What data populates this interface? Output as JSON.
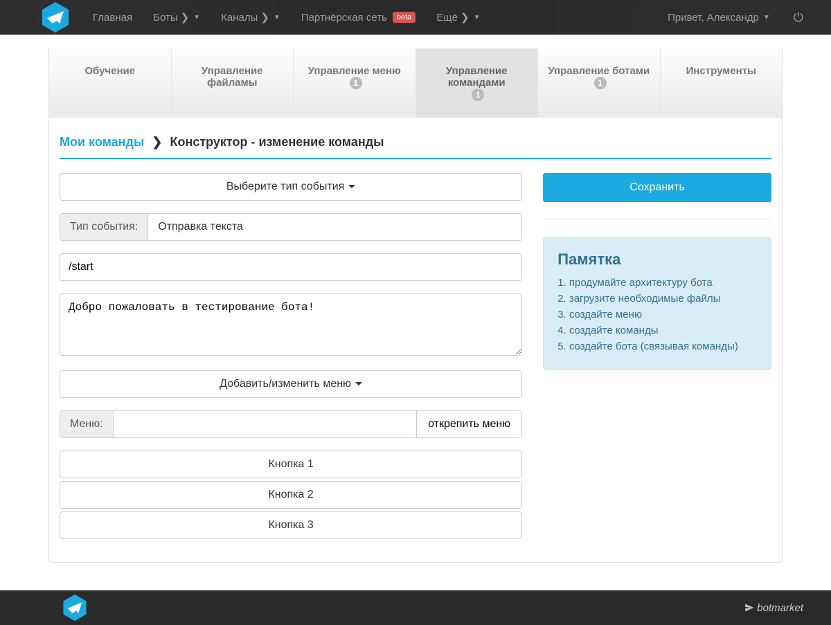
{
  "nav": {
    "items": [
      {
        "label": "Главная"
      },
      {
        "label": "Боты",
        "dropdown": true
      },
      {
        "label": "Каналы",
        "dropdown": true
      },
      {
        "label": "Партнёрская сеть",
        "beta": true,
        "beta_label": "beta"
      },
      {
        "label": "Ещё",
        "dropdown": true
      }
    ],
    "greeting": "Привет, Александр"
  },
  "tabs": [
    {
      "label": "Обучение"
    },
    {
      "label": "Управление файламы"
    },
    {
      "label": "Управление меню",
      "count": "1"
    },
    {
      "label": "Управление командами",
      "count": "1",
      "active": true
    },
    {
      "label": "Управление ботами",
      "count": "1"
    },
    {
      "label": "Инструменты"
    }
  ],
  "breadcrumb": {
    "link": "Мои команды",
    "current": "Конструктор - изменение команды"
  },
  "form": {
    "event_type_selector": "Выберите тип события",
    "event_type_label": "Тип события:",
    "event_type_value": "Отправка текста",
    "command_value": "/start",
    "text_value": "Добро пожаловать в тестирование бота!",
    "menu_selector": "Добавить/изменить меню",
    "menu_label": "Меню:",
    "menu_value": "",
    "menu_unpin": "открепить меню",
    "buttons": [
      "Кнопка 1",
      "Кнопка 2",
      "Кнопка 3"
    ]
  },
  "sidebar": {
    "save_label": "Сохранить",
    "memo_title": "Памятка",
    "memo_items": [
      "продумайте архитектуру бота",
      "загрузите необходимые файлы",
      "создайте меню",
      "создайте команды",
      "создайте бота (связывая команды)"
    ]
  },
  "footer": {
    "brand": "botmarket"
  },
  "colors": {
    "accent": "#1aaae0",
    "info_bg": "#d9edf7"
  }
}
